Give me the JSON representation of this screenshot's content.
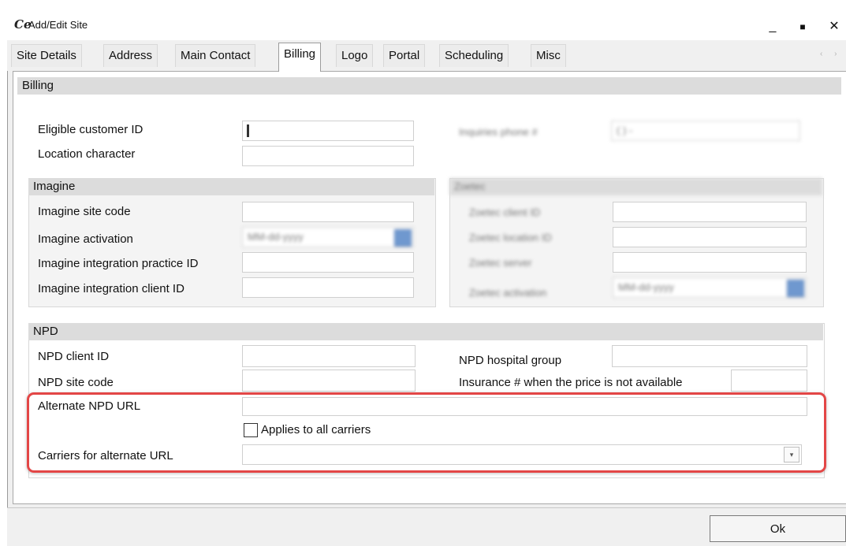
{
  "window": {
    "title": "Add/Edit Site",
    "minimize": "_",
    "maximize": "■",
    "close": "✕",
    "icon": "app-logo-icon"
  },
  "tabs": [
    {
      "label": "Site Details"
    },
    {
      "label": "Address"
    },
    {
      "label": "Main Contact"
    },
    {
      "label": "Billing",
      "active": true
    },
    {
      "label": "Logo"
    },
    {
      "label": "Portal"
    },
    {
      "label": "Scheduling"
    },
    {
      "label": "Misc"
    }
  ],
  "tab_scroll_arrows": "‹ ›",
  "billing": {
    "header": "Billing",
    "eligible_customer_id_label": "Eligible customer ID",
    "location_character_label": "Location character",
    "inquiries_phone_label": "Inquiries phone #",
    "inquiries_phone_value": "(  ) -"
  },
  "imagine": {
    "header": "Imagine",
    "site_code_label": "Imagine site code",
    "activation_label": "Imagine activation",
    "activation_placeholder": "MM-dd-yyyy",
    "practice_id_label": "Imagine integration practice ID",
    "client_id_label": "Imagine integration client ID"
  },
  "zoetec": {
    "header": "Zoetec",
    "client_id_label": "Zoetec client ID",
    "location_id_label": "Zoetec location ID",
    "server_label": "Zoetec server",
    "activation_label": "Zoetec activation",
    "activation_placeholder": "MM-dd-yyyy"
  },
  "npd": {
    "header": "NPD",
    "client_id_label": "NPD client ID",
    "site_code_label": "NPD site code",
    "hospital_group_label": "NPD hospital group",
    "insurance_label": "Insurance # when the price is not available",
    "alternate_url_label": "Alternate NPD URL",
    "applies_all_label": "Applies to all carriers",
    "applies_all_checked": false,
    "carriers_label": "Carriers for alternate URL",
    "carriers_value": ""
  },
  "footer": {
    "ok_label": "Ok"
  },
  "colors": {
    "highlight": "#e34646",
    "date_button": "#6f98cf"
  }
}
